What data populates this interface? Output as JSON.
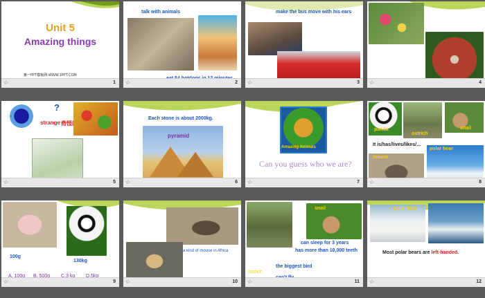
{
  "slides": [
    {
      "num": "1",
      "title_line1": "Unit 5",
      "title_line2": "Amazing things",
      "footer_text": "第一PPT模板网-WWW.1PPT.COM"
    },
    {
      "num": "2",
      "caption_top": "talk with animals",
      "caption_bottom": "eat 54 hotdogs  in 12 minutes"
    },
    {
      "num": "3",
      "caption_top": "make the bus move with his ears"
    },
    {
      "num": "4"
    },
    {
      "num": "5",
      "word_en": "strange",
      "word_cn": "奇怪的",
      "question": "?"
    },
    {
      "num": "6",
      "caption": "Each stone is about 2000kg.",
      "label": "pyramid"
    },
    {
      "num": "7",
      "caption": "Can you guess who we are?",
      "book_title": "Amazing Animals"
    },
    {
      "num": "8",
      "label_panda": "panda",
      "label_ostrich": "ostrich",
      "label_snail": "snail",
      "sentence": "It is/has/lives/likes/…",
      "label_polar": "polar bear",
      "label_mouse": "mouse"
    },
    {
      "num": "9",
      "weight1": "100g",
      "weight2": "130kg",
      "options": [
        "A. 100g",
        "B. 500g",
        "C.3 kg",
        "D.5kg"
      ]
    },
    {
      "num": "10",
      "caption": "a kind of mouse in Africa"
    },
    {
      "num": "11",
      "label_snail": "snail",
      "snail_fact1": "can sleep for 3 years",
      "snail_fact2": "has more than 10,000 teeth",
      "label_ostrich": "ostrich",
      "ostrich_fact1": "the biggest bird",
      "ostrich_fact2": "can't fly"
    },
    {
      "num": "12",
      "label": "polar bear",
      "sentence_pre": "Most  polar bears are ",
      "sentence_hl": "left-handed",
      "sentence_post": "."
    }
  ],
  "colors": {
    "caption_blue": "#1a56c4",
    "purple": "#7b2fa8",
    "red": "#e02020",
    "background": "#5a5a5a"
  }
}
